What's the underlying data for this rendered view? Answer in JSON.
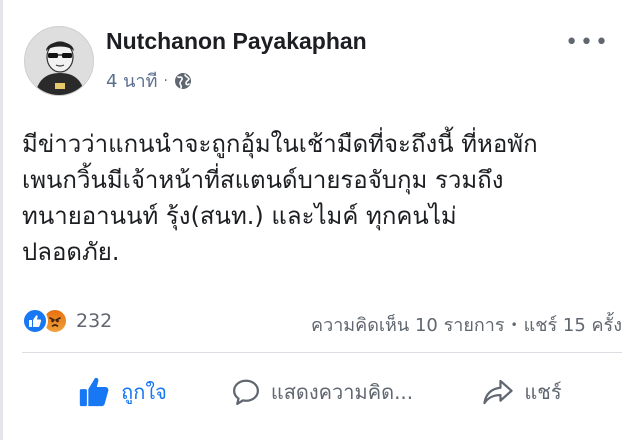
{
  "post": {
    "author": "Nutchanon Payakaphan",
    "time": "4 นาที",
    "meta_separator": "·",
    "privacy_icon": "globe-icon",
    "more_label": "•••",
    "text_lines": [
      "มีข่าวว่าแกนนำจะถูกอุ้มในเช้ามืดที่จะถึงนี้ ที่หอพัก",
      "เพนกวิ้นมีเจ้าหน้าที่สแตนด์บายรอจับกุม รวมถึง",
      "ทนายอานนท์ รุ้ง(สนท.) และไมค์ ทุกคนไม่",
      "ปลอดภัย."
    ]
  },
  "stats": {
    "reaction_icons": [
      "like-icon",
      "angry-icon"
    ],
    "reaction_count": "232",
    "comments": "ความคิดเห็น 10 รายการ",
    "separator": "•",
    "shares": "แชร์ 15 ครั้ง"
  },
  "actions": {
    "like": "ถูกใจ",
    "comment": "แสดงความคิด...",
    "share": "แชร์"
  },
  "colors": {
    "brand_blue": "#1877f2",
    "meta_text": "#5b6f8f",
    "secondary_text": "#606770",
    "angry_orange": "#e9710f"
  }
}
